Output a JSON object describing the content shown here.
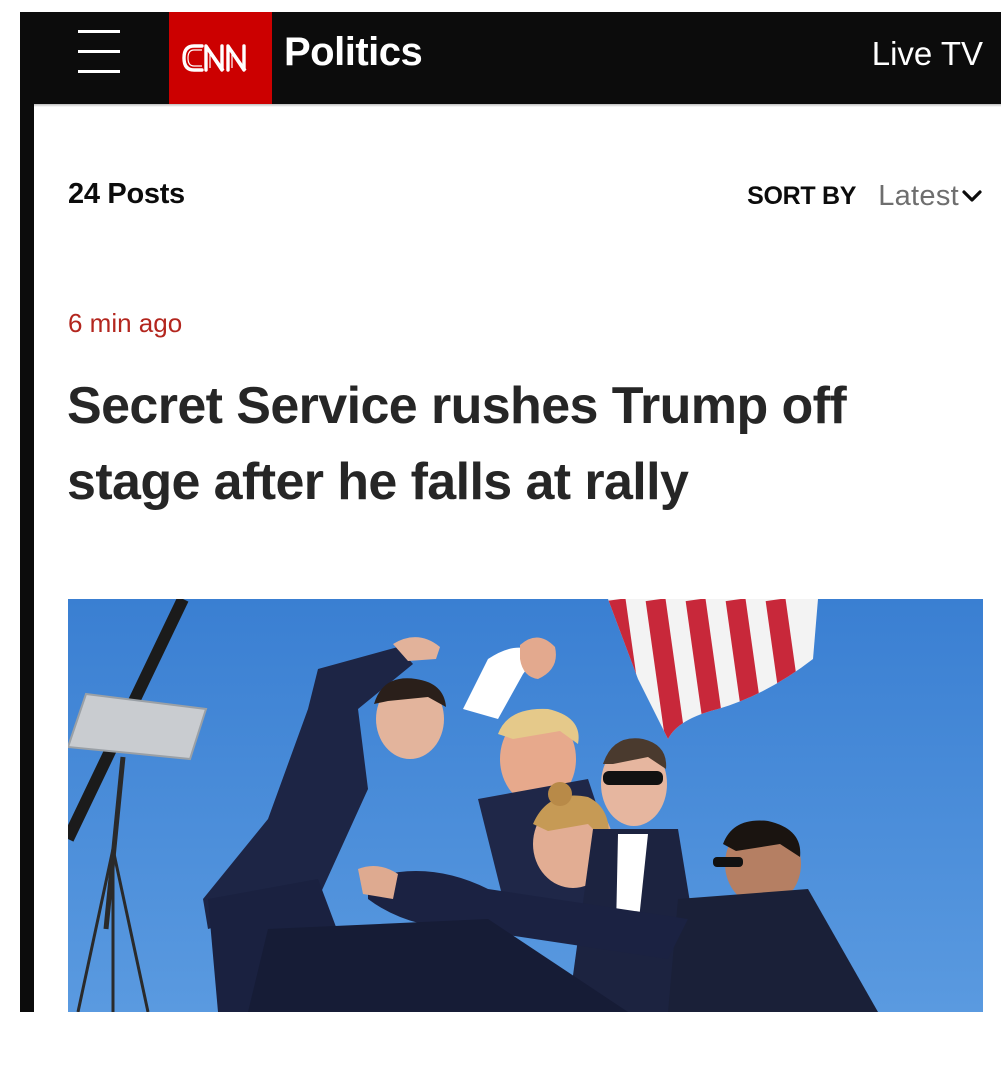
{
  "header": {
    "brand": "CNN",
    "section": "Politics",
    "live_tv": "Live TV"
  },
  "feed": {
    "posts_count": "24 Posts",
    "sort_label": "SORT BY",
    "sort_value": "Latest"
  },
  "post": {
    "timestamp": "6 min ago",
    "headline": "Secret Service rushes Trump off stage after he falls at rally"
  },
  "colors": {
    "header_bg": "#0c0c0c",
    "brand_red": "#cc0000",
    "timestamp_red": "#b3261e",
    "headline": "#262626",
    "sort_value_gray": "#6e6e6e",
    "sky_blue": "#3f86d6"
  },
  "icons": {
    "menu": "hamburger-menu-icon",
    "sort_dropdown": "chevron-down-icon"
  }
}
